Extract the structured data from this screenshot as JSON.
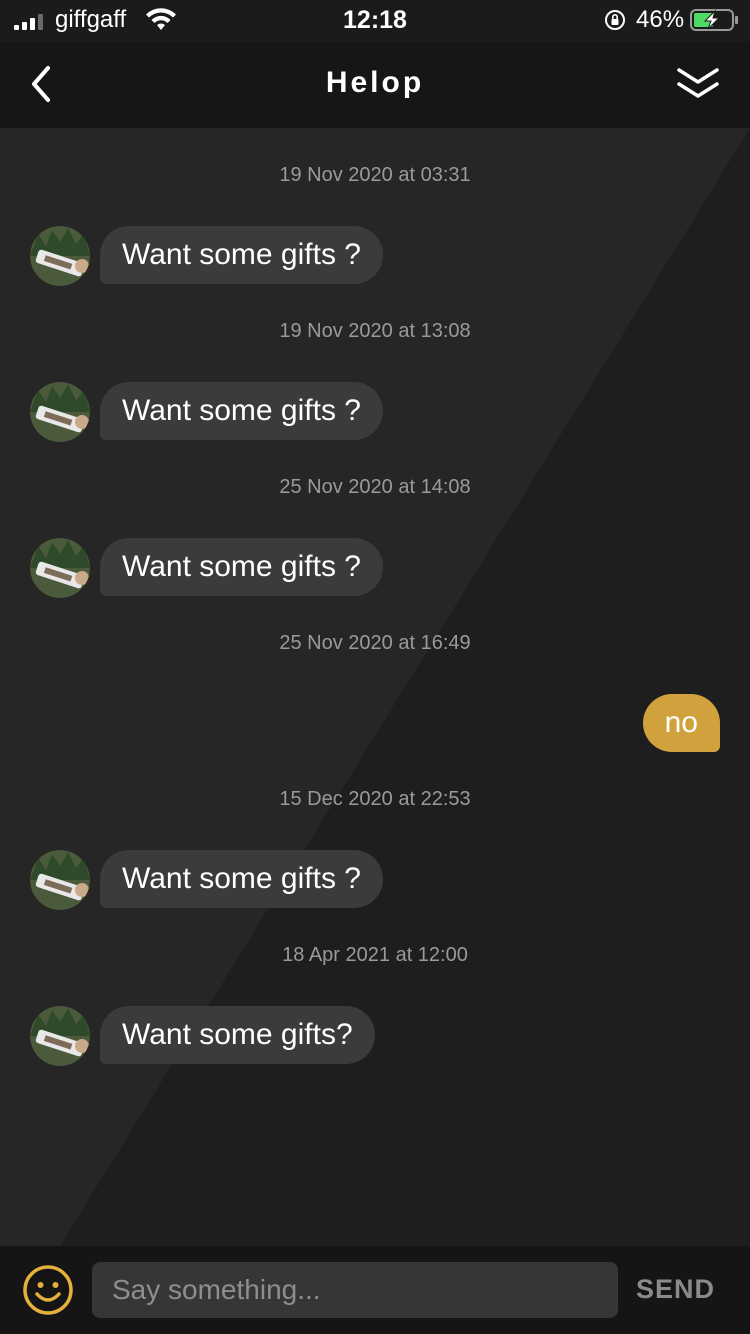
{
  "status_bar": {
    "carrier": "giffgaff",
    "time": "12:18",
    "battery": "46%",
    "icons": [
      "signal-icon",
      "wifi-icon",
      "orientation-lock-icon",
      "battery-charging-icon"
    ]
  },
  "header": {
    "title": "Helop",
    "back_icon": "chevron-left-icon",
    "collapse_icon": "double-chevron-down-icon"
  },
  "messages": [
    {
      "timestamp": "19 Nov 2020 at 03:31",
      "direction": "incoming",
      "text": "Want some gifts ?"
    },
    {
      "timestamp": "19 Nov 2020 at 13:08",
      "direction": "incoming",
      "text": "Want some gifts ?"
    },
    {
      "timestamp": "25 Nov 2020 at 14:08",
      "direction": "incoming",
      "text": "Want some gifts ?"
    },
    {
      "timestamp": "25 Nov 2020 at 16:49",
      "direction": "outgoing",
      "text": "no"
    },
    {
      "timestamp": "15 Dec 2020 at 22:53",
      "direction": "incoming",
      "text": "Want some gifts ?"
    },
    {
      "timestamp": "18 Apr 2021 at 12:00",
      "direction": "incoming",
      "text": "Want some gifts?"
    }
  ],
  "composer": {
    "placeholder": "Say something...",
    "send_label": "SEND",
    "emoji_icon": "smiley-icon"
  },
  "colors": {
    "outgoing_bubble": "#d1a13d",
    "incoming_bubble": "#3b3b3b",
    "emoji_accent": "#e5b13c"
  }
}
